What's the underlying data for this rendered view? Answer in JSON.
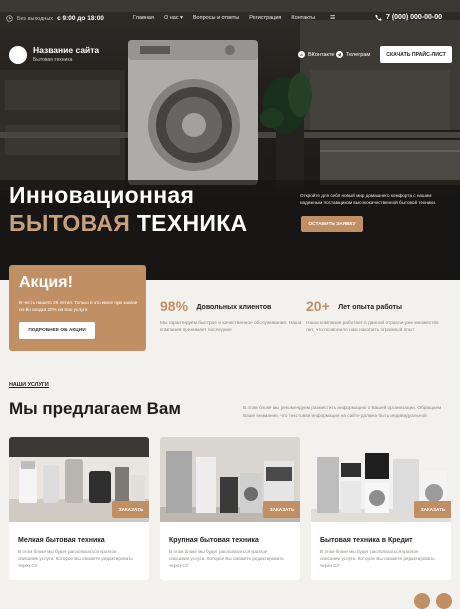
{
  "topbar": {
    "hours_label": "Без выходных",
    "hours_value": "с 9:00 до 18:00",
    "nav": [
      "Главная",
      "О нас",
      "Вопросы и ответы",
      "Регистрация",
      "Контакты"
    ],
    "phone": "7 (000) 000-00-00"
  },
  "brand": {
    "name": "Название сайта",
    "subtitle": "Бытовая техника"
  },
  "social": {
    "vk": "ВКонтакте",
    "telegram": "Телеграм"
  },
  "hero": {
    "price_button": "СКАЧАТЬ ПРАЙС-ЛИСТ",
    "title_line1": "Инновационная",
    "title_accent": "БЫТОВАЯ",
    "title_rest": "ТЕХНИКА",
    "description": "Откройте для себя новый мир домашнего комфорта с нашим надежным поставщиком высококачественной бытовой техники.",
    "request_button": "ОСТАВИТЬ ЗАЯВКУ"
  },
  "promo": {
    "title": "Акция!",
    "text": "В честь нашего 25 летия. Только в это июне при заказе он-йн скидка 20% на всю услуги",
    "button": "ПОДРОБНЕЕ ОБ АКЦИИ"
  },
  "stats": [
    {
      "number": "98%",
      "label": "Довольных клиентов",
      "text": "Мы гарантируем быстрое и качественное обслуживание. Наша компания принимает последние"
    },
    {
      "number": "20+",
      "label": "Лет опыта работы",
      "text": "Наша компания работает в данной отрасли уже множество лет, что позволило нам накопить огромный опыт"
    }
  ],
  "services": {
    "link": "НАШИ УСЛУГИ",
    "title": "Мы предлагаем Вам",
    "description": "В этом блоке мы рекомендуем разместить информацию о Вашей организации. Обращаем Ваше внимание, что текстовая информация на сайте должна быть индивидуальной",
    "cards": [
      {
        "title": "Мелкая бытовая техника",
        "text": "В этом блоке мы будет располагаться краткое описание услуги. Которое Вы сможете редактировать через CУ",
        "button": "ЗАКАЗАТЬ"
      },
      {
        "title": "Крупная бытовая техника",
        "text": "В этом блоке мы будет располагаться краткое описание услуги. Которое Вы сможете редактировать через CУ",
        "button": "ЗАКАЗАТЬ"
      },
      {
        "title": "Бытовая техника в Кредит",
        "text": "В этом блоке мы будет располагаться краткое описание услуги. Которое Вы сможете редактировать через CУ",
        "button": "ЗАКАЗАТЬ"
      }
    ]
  },
  "colors": {
    "accent": "#c18f64",
    "dark": "#1d1b19",
    "page_bg": "#f3f1ee"
  },
  "icons": [
    "clock-icon",
    "menu-icon",
    "phone-icon",
    "vk-icon",
    "telegram-icon"
  ]
}
